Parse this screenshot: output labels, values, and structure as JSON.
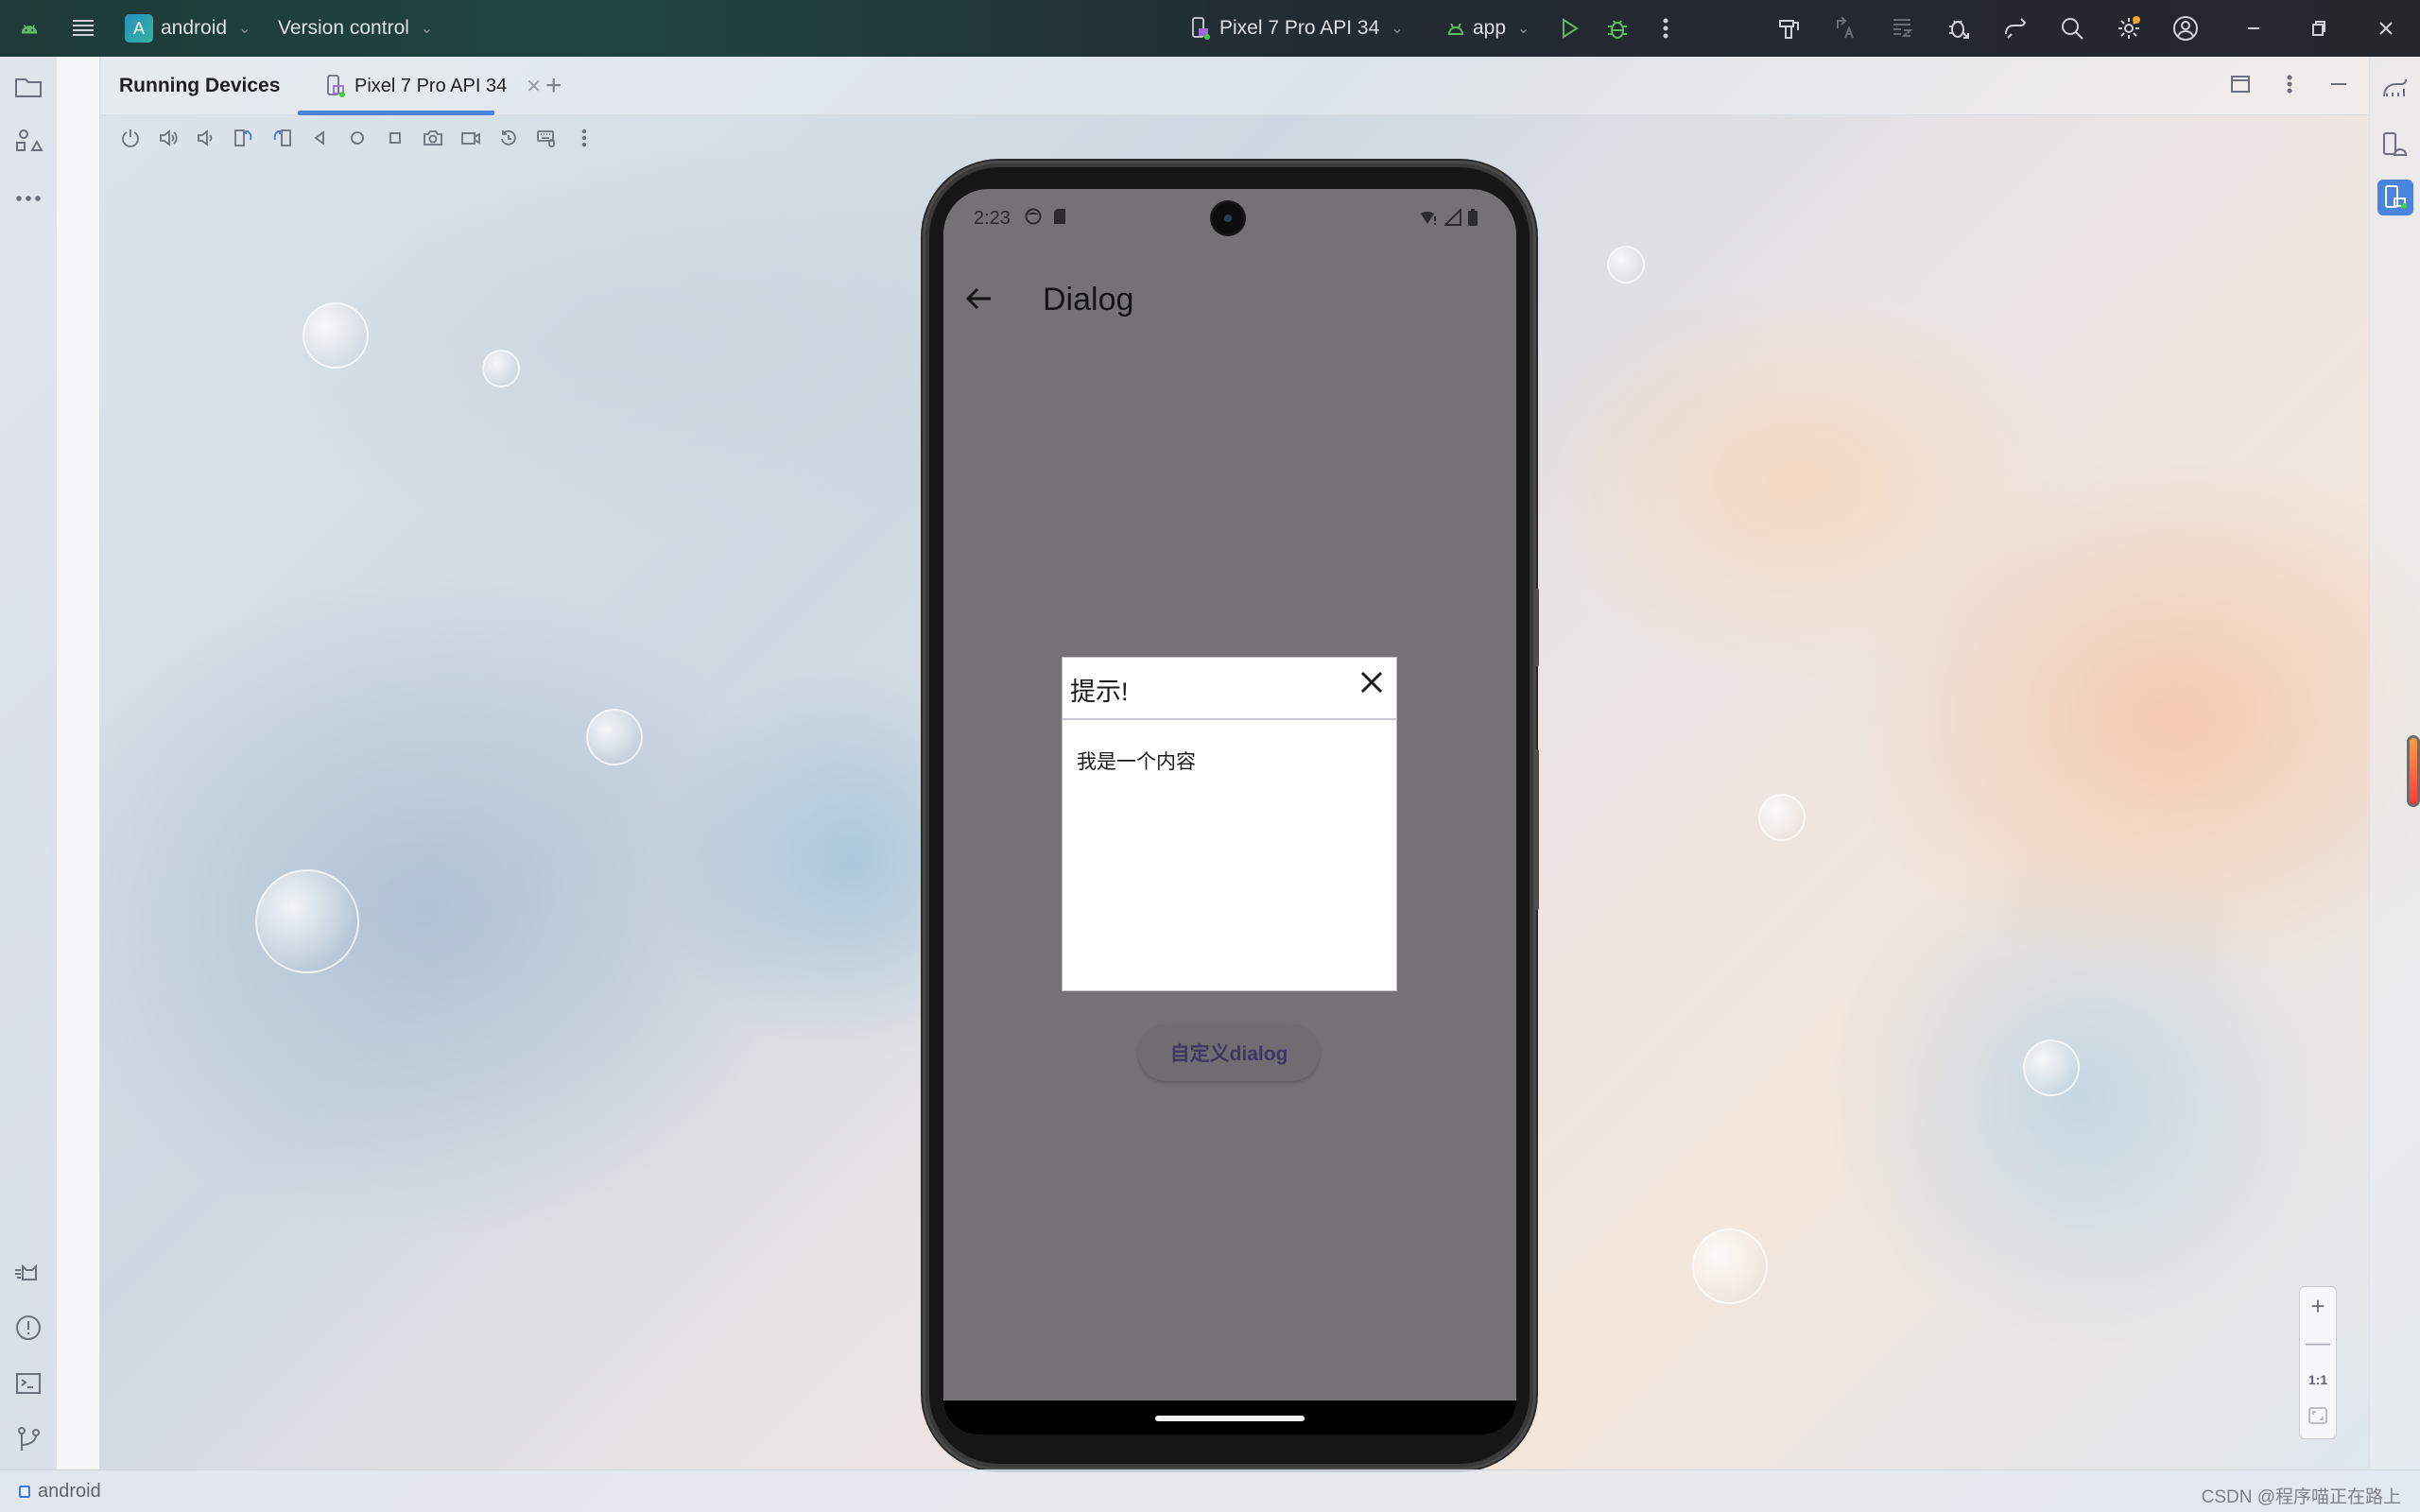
{
  "titlebar": {
    "project_initial": "A",
    "project_name": "android",
    "version_control": "Version control",
    "device_selector": "Pixel 7 Pro API 34",
    "run_config": "app",
    "accent_color": "#5fb865"
  },
  "tool_window": {
    "title": "Running Devices",
    "tabs": [
      {
        "label": "Pixel 7 Pro API 34",
        "active": true
      }
    ]
  },
  "emulator_toolbar": {
    "buttons": [
      "power",
      "volume-up",
      "volume-down",
      "rotate-left",
      "rotate-right",
      "back",
      "home",
      "overview",
      "screenshot",
      "screen-record",
      "reset",
      "keyboard-mouse",
      "more"
    ]
  },
  "device": {
    "status_bar": {
      "time": "2:23"
    },
    "app_bar": {
      "title": "Dialog"
    },
    "button_label": "自定义dialog",
    "dialog": {
      "title": "提示!",
      "content": "我是一个内容"
    }
  },
  "zoom_controls": {
    "zoom_in": "+",
    "zoom_out": "—",
    "actual_size": "1:1"
  },
  "statusbar": {
    "project": "android",
    "watermark": "CSDN @程序喵正在路上"
  }
}
